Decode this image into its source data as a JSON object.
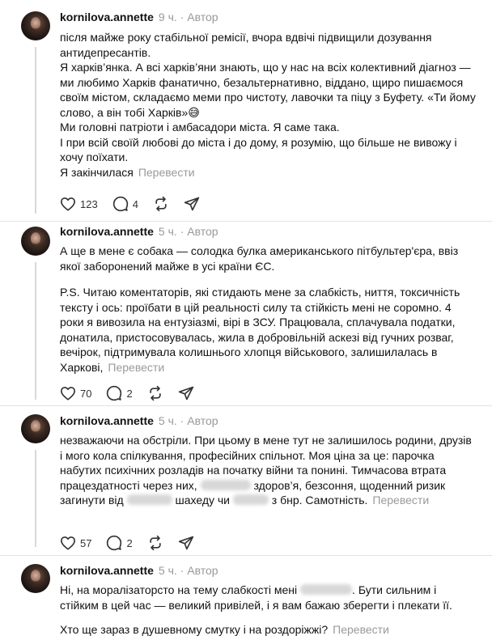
{
  "posts": [
    {
      "username": "kornilova.annette",
      "time": "9 ч.",
      "author_badge": "Автор",
      "paragraphs": [
        "після майже року стабільної ремісії, вчора вдвічі підвищили дозування антидепресантів.",
        "Я харків’янка. А всі харків’яни знають, що у нас на всіх колективний діагноз — ми любимо Харків фанатично, безальтернативно, віддано, щиро пишаємося своїм містом, складаємо меми про чистоту, лавочки та піцу з Буфету. «Ти йому слово, а він тобі Харків»😅",
        "Ми головні патріоти і амбасадори міста. Я саме така.",
        "І при всій своїй любові до міста і до дому, я розумію, що більше не вивожу і хочу поїхати.",
        "Я закінчилася"
      ],
      "translate": "Перевести",
      "likes": "123",
      "comments": "4"
    },
    {
      "username": "kornilova.annette",
      "time": "5 ч.",
      "author_badge": "Автор",
      "paragraphs": [
        "А ще в мене є собака — солодка булка американського пітбультер'єра, ввіз якої заборонений майже в усі країни ЄС.",
        "P.S. Читаю коментаторів, які стидають мене за слабкість, ниття, токсичність тексту і ось: проїбати в цій реальності силу та стійкість мені не соромно. 4 роки я вивозила на ентузіазмі, вірі в ЗСУ. Працювала, сплачувала податки, донатила, пристосовувалась, жила в добровільній аскезі від гучних розваг, вечірок, підтримувала колишнього хлопця військового, залишилалась в Харкові,"
      ],
      "translate": "Перевести",
      "likes": "70",
      "comments": "2"
    },
    {
      "username": "kornilova.annette",
      "time": "5 ч.",
      "author_badge": "Автор",
      "p1": "незважаючи на обстріли. При цьому в мене тут не залишилось родини, друзів і мого кола спілкування, професійних спільнот. Моя ціна за це: парочка набутих психічних розладів на початку війни та понині. Тимчасова втрата працездатності через них,",
      "p2": "здоров’я, безсоння, щоденний ризик загинути від",
      "p3": "шахеду чи",
      "p4": "з бнр.",
      "p5": "Самотність.",
      "translate": "Перевести",
      "likes": "57",
      "comments": "2"
    },
    {
      "username": "kornilova.annette",
      "time": "5 ч.",
      "author_badge": "Автор",
      "p1": "Ні, на моралізаторсто на тему слабкості мені",
      "p2": ". Бути сильним і стійким в цей час — великий привілей, і я вам бажаю зберегти і плекати її.",
      "p3": "Хто ще зараз в душевному смутку і на роздоріжжі?",
      "translate": "Перевести"
    }
  ],
  "icons": [
    "heart-icon",
    "comment-icon",
    "repost-icon",
    "share-icon"
  ]
}
